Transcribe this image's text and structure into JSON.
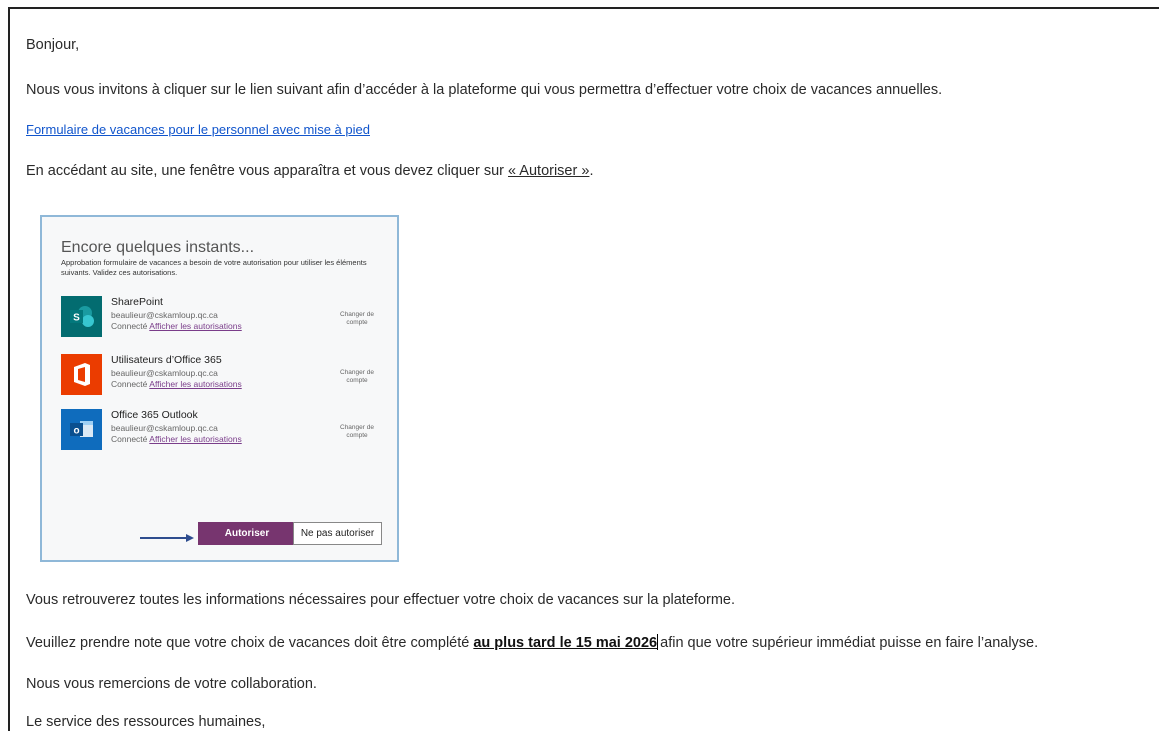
{
  "email": {
    "greeting": "Bonjour,",
    "intro": "Nous vous invitons à cliquer sur le lien suivant afin d’accéder à la plateforme qui vous permettra d’effectuer votre choix de vacances annuelles.",
    "link_text": "Formulaire de vacances pour le personnel avec mise à pied",
    "instruction_before": "En accédant au site, une fenêtre vous apparaîtra et vous devez cliquer sur ",
    "instruction_link": "« Autoriser »",
    "instruction_after": ".",
    "info": "Vous retrouverez toutes les informations nécessaires pour effectuer votre choix de vacances sur la plateforme.",
    "deadline_before": "Veuillez prendre note que votre choix de vacances doit être complété ",
    "deadline_bold": "au plus tard le 15 mai 2026",
    "deadline_after": "afin que votre supérieur immédiat puisse en faire l’analyse.",
    "thanks": "Nous vous remercions de votre collaboration.",
    "signature": "Le service des ressources humaines,"
  },
  "dialog": {
    "title": "Encore quelques instants...",
    "description": "Approbation formulaire de vacances a besoin de votre autorisation pour utiliser les éléments suivants. Validez ces autorisations.",
    "services": [
      {
        "name": "SharePoint",
        "email": "beaulieur@cskamloup.qc.ca",
        "status": "Connecté",
        "permissions_link": "Afficher les autorisations",
        "change_account": "Changer de compte",
        "icon": "sharepoint-icon",
        "color": "#036c70"
      },
      {
        "name": "Utilisateurs d’Office 365",
        "email": "beaulieur@cskamloup.qc.ca",
        "status": "Connecté",
        "permissions_link": "Afficher les autorisations",
        "change_account": "Changer de compte",
        "icon": "office365-icon",
        "color": "#eb3c00"
      },
      {
        "name": "Office 365 Outlook",
        "email": "beaulieur@cskamloup.qc.ca",
        "status": "Connecté",
        "permissions_link": "Afficher les autorisations",
        "change_account": "Changer de compte",
        "icon": "outlook-icon",
        "color": "#0f6cbd"
      }
    ],
    "allow_button": "Autoriser",
    "deny_button": "Ne pas autoriser"
  }
}
